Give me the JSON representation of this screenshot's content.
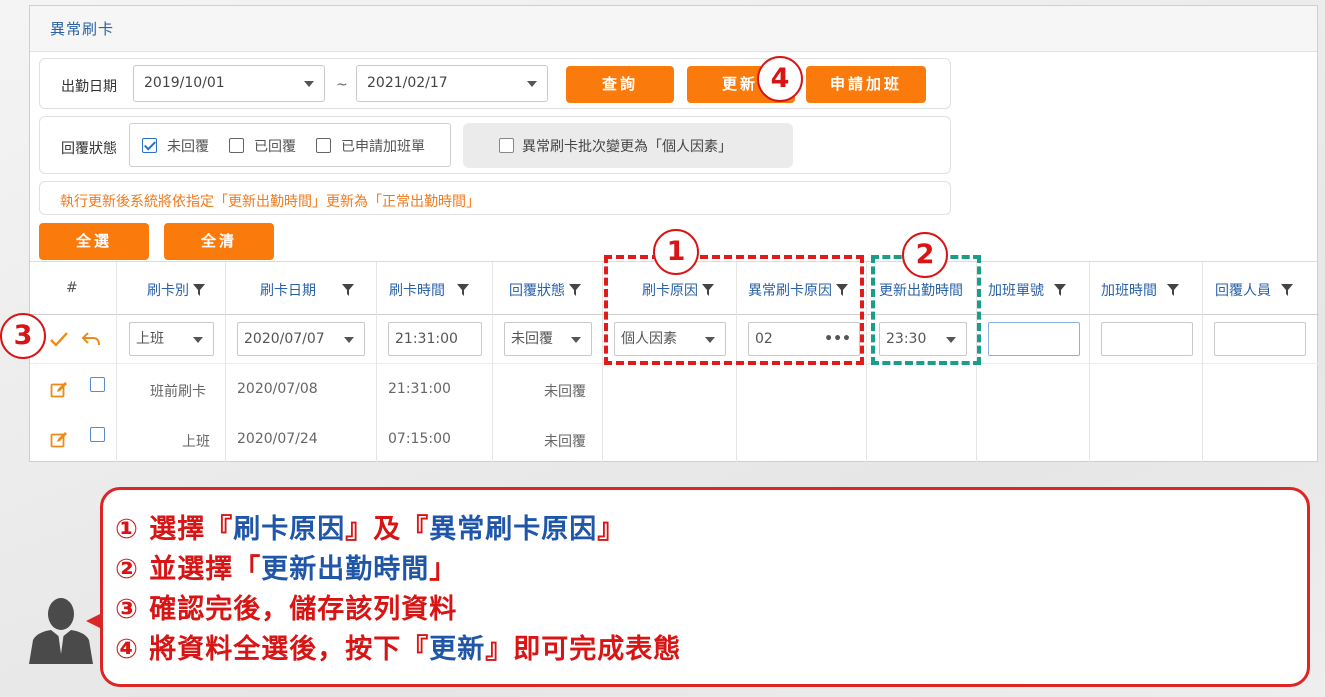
{
  "panel": {
    "title": "異常刷卡"
  },
  "filters": {
    "date_label": "出勤日期",
    "date_from": "2019/10/01",
    "date_sep": "~",
    "date_to": "2021/02/17",
    "query_btn": "查詢",
    "update_btn": "更新",
    "overtime_btn": "申請加班",
    "reply_label": "回覆狀態",
    "opt_unreplied": "未回覆",
    "opt_replied": "已回覆",
    "opt_applied_ot": "已申請加班單",
    "batch_change_label": "異常刷卡批次變更為「個人因素」",
    "notice": "執行更新後系統將依指定「更新出勤時間」更新為「正常出勤時間」",
    "select_all_btn": "全選",
    "clear_all_btn": "全清"
  },
  "table": {
    "headers": [
      "#",
      "刷卡別",
      "刷卡日期",
      "刷卡時間",
      "回覆狀態",
      "刷卡原因",
      "異常刷卡原因",
      "更新出勤時間",
      "加班單號",
      "加班時間",
      "回覆人員"
    ],
    "edit_row": {
      "card_type": "上班",
      "card_date": "2020/07/07",
      "card_time": "21:31:00",
      "reply_status": "未回覆",
      "reason": "個人因素",
      "abnormal_reason": "02",
      "abnormal_more": "•••",
      "update_time": "23:30"
    },
    "rows": [
      {
        "card_type": "班前刷卡",
        "card_date": "2020/07/08",
        "card_time": "21:31:00",
        "reply_status": "未回覆"
      },
      {
        "card_type": "上班",
        "card_date": "2020/07/24",
        "card_time": "07:15:00",
        "reply_status": "未回覆"
      }
    ]
  },
  "markers": {
    "m1": "1",
    "m2": "2",
    "m3": "3",
    "m4": "4"
  },
  "notes": {
    "n1_a": "① 選擇『",
    "n1_b": "刷卡原因",
    "n1_c": "』及『",
    "n1_d": "異常刷卡原因",
    "n1_e": "』",
    "n2_a": "② 並選擇「",
    "n2_b": "更新出勤時間",
    "n2_c": "」",
    "n3": "③ 確認完後，儲存該列資料",
    "n4_a": "④ 將資料全選後，按下『",
    "n4_b": "更新",
    "n4_c": "』即可完成表態"
  },
  "colors": {
    "accent": "#fb7a0c",
    "link": "#2a62a8",
    "alert": "#d81414",
    "highlight_green": "#1a9e88"
  }
}
